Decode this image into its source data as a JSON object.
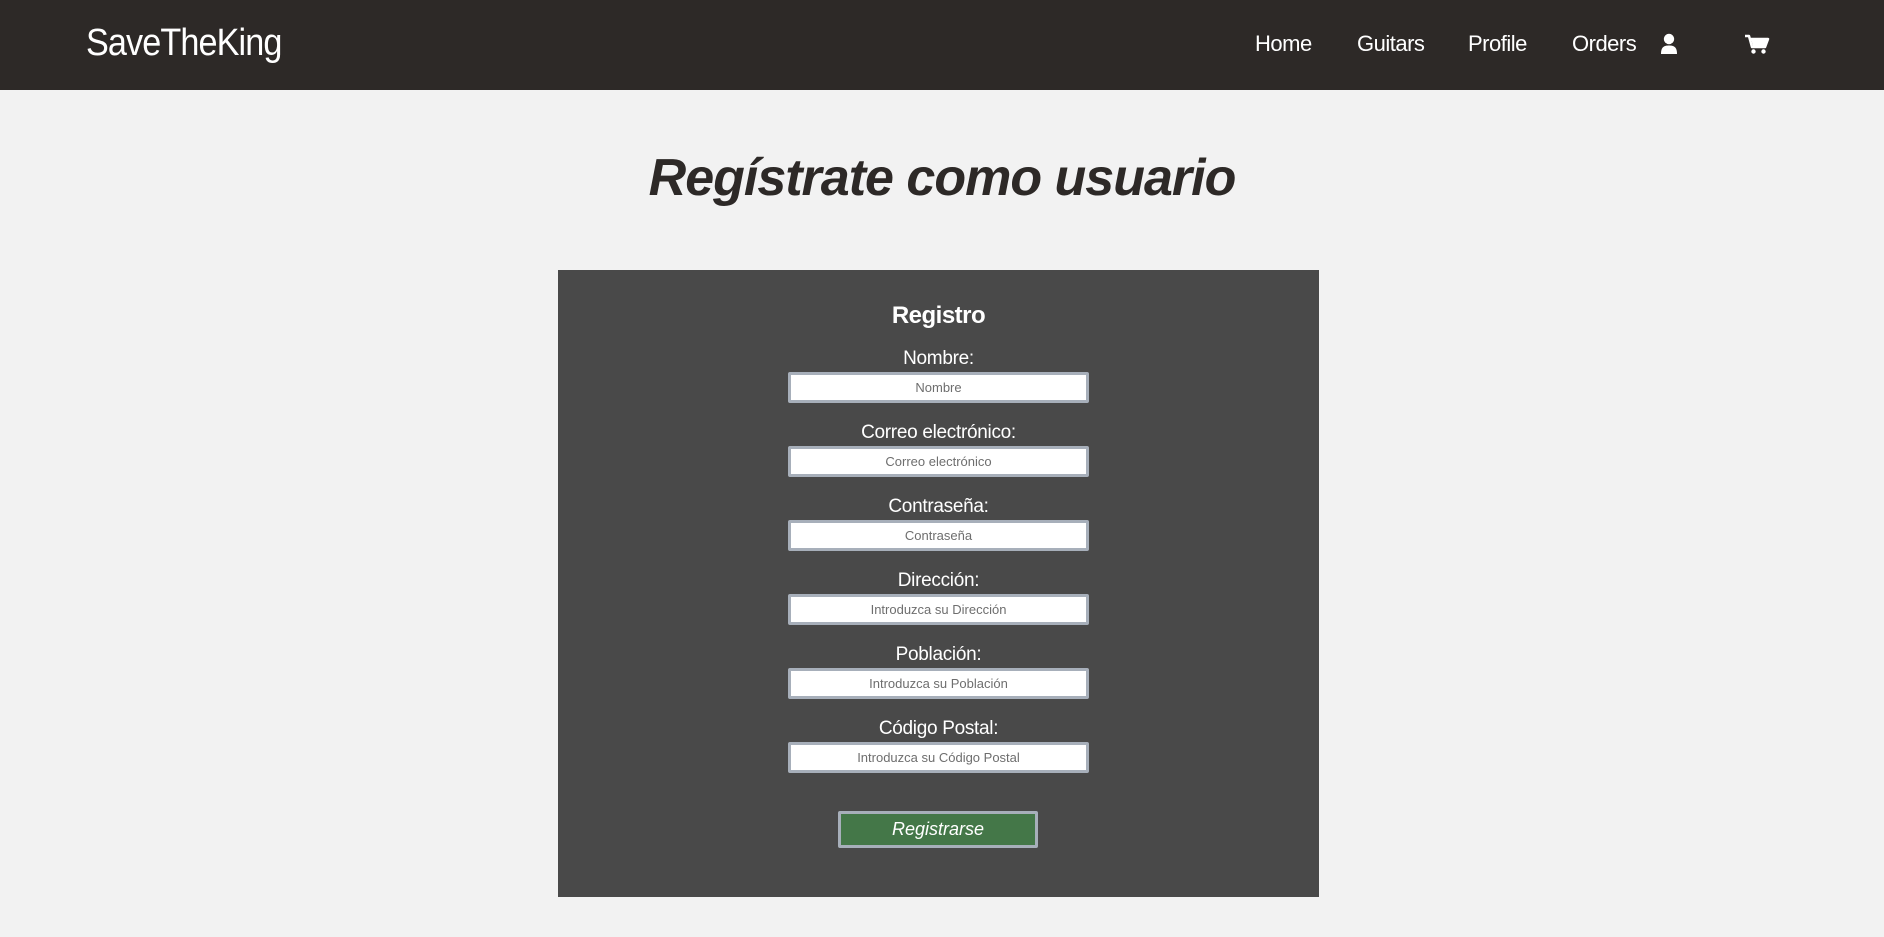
{
  "navbar": {
    "brand": "SaveTheKing",
    "links": [
      {
        "label": "Home"
      },
      {
        "label": "Guitars"
      },
      {
        "label": "Profile"
      },
      {
        "label": "Orders"
      }
    ],
    "icons": [
      "user-icon",
      "cart-icon"
    ]
  },
  "page": {
    "title": "Regístrate como usuario"
  },
  "form": {
    "title": "Registro",
    "fields": [
      {
        "label": "Nombre:",
        "placeholder": "Nombre"
      },
      {
        "label": "Correo electrónico:",
        "placeholder": "Correo electrónico"
      },
      {
        "label": "Contraseña:",
        "placeholder": "Contraseña"
      },
      {
        "label": "Dirección:",
        "placeholder": "Introduzca su Dirección"
      },
      {
        "label": "Población:",
        "placeholder": "Introduzca su Población"
      },
      {
        "label": "Código Postal:",
        "placeholder": "Introduzca su Código Postal"
      }
    ],
    "submit_label": "Registrarse"
  },
  "colors": {
    "navbar_bg": "#2d2927",
    "page_bg": "#f2f2f2",
    "panel_bg": "#494949",
    "button_bg": "#447748",
    "input_border": "#a7afba"
  }
}
